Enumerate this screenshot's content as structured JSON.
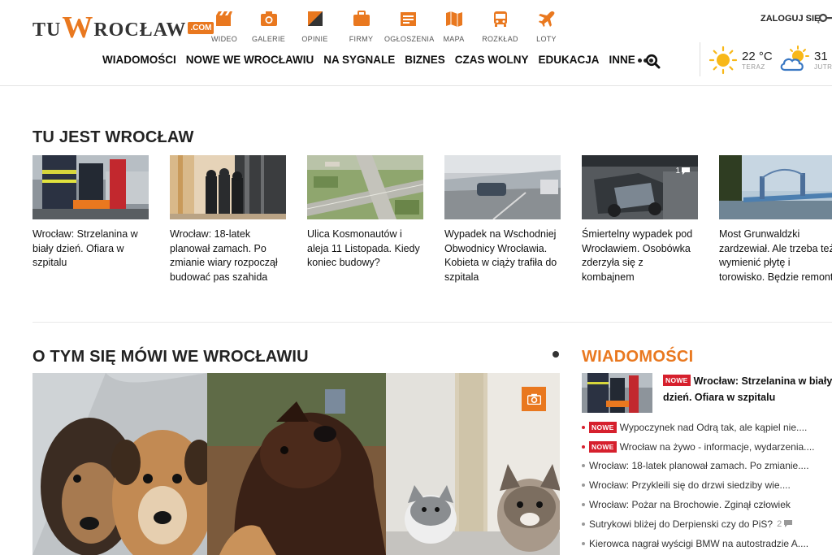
{
  "logo": {
    "part1": "TU",
    "w": "W",
    "part2": "ROCŁAW",
    "com": ".COM"
  },
  "top_icons": [
    {
      "label": "WIDEO",
      "icon": "video-icon"
    },
    {
      "label": "GALERIE",
      "icon": "camera-icon"
    },
    {
      "label": "OPINIE",
      "icon": "opinion-icon"
    },
    {
      "label": "FIRMY",
      "icon": "briefcase-icon"
    },
    {
      "label": "OGŁOSZENIA",
      "icon": "classifieds-icon"
    },
    {
      "label": "MAPA",
      "icon": "map-icon"
    },
    {
      "label": "ROZKŁAD",
      "icon": "bus-icon"
    },
    {
      "label": "LOTY",
      "icon": "plane-icon"
    }
  ],
  "login": {
    "label": "ZALOGUJ SIĘ"
  },
  "nav": [
    "WIADOMOŚCI",
    "NOWE WE WROCŁAWIU",
    "NA SYGNALE",
    "BIZNES",
    "CZAS WOLNY",
    "EDUKACJA",
    "INNE"
  ],
  "weather": {
    "today": {
      "temp": "22 °C",
      "label": "TERAZ",
      "icon": "sun-icon"
    },
    "tomorrow": {
      "temp": "31",
      "label": "JUTR",
      "icon": "cloud-sun-icon"
    }
  },
  "section1": {
    "title": "TU JEST WROCŁAW",
    "cards": [
      {
        "title": "Wrocław: Strzelanina w biały dzień. Ofiara w szpitalu"
      },
      {
        "title": "Wrocław: 18-latek planował zamach. Po zmianie wiary rozpoczął budować pas szahida"
      },
      {
        "title": "Ulica Kosmonautów i aleja 11 Listopada. Kiedy koniec budowy?"
      },
      {
        "title": "Wypadek na Wschodniej Obwodnicy Wrocławia. Kobieta w ciąży trafiła do szpitala"
      },
      {
        "title": "Śmiertelny wypadek pod Wrocławiem. Osobówka zderzyła się z kombajnem",
        "badge": "1"
      },
      {
        "title": "Most Grunwaldzki zardzewiał. Ale trzeba też wymienić płytę i torowisko. Będzie remont"
      }
    ]
  },
  "section2": {
    "title": "O TYM SIĘ MÓWI WE WROCŁAWIU"
  },
  "news": {
    "title": "WIADOMOŚCI",
    "badge_label": "NOWE",
    "lead": {
      "title": "Wrocław: Strzelanina w biały dzień. Ofiara w szpitalu"
    },
    "items": [
      {
        "text": "Wypoczynek nad Odrą tak, ale kąpiel nie....",
        "new": true
      },
      {
        "text": "Wrocław na żywo - informacje, wydarzenia....",
        "new": true
      },
      {
        "text": "Wrocław: 18-latek planował zamach. Po zmianie....",
        "new": false
      },
      {
        "text": "Wrocław: Przykleili się do drzwi siedziby wie....",
        "new": false
      },
      {
        "text": "Wrocław: Pożar na Brochowie. Zginął człowiek",
        "new": false
      },
      {
        "text": "Sutrykowi bliżej do Derpienski czy do PiS?",
        "new": false,
        "comments": "2"
      },
      {
        "text": "Kierowca nagrał wyścigi BMW na autostradzie A....",
        "new": false
      }
    ]
  },
  "colors": {
    "accent": "#e9781f",
    "badge": "#d6202d"
  }
}
